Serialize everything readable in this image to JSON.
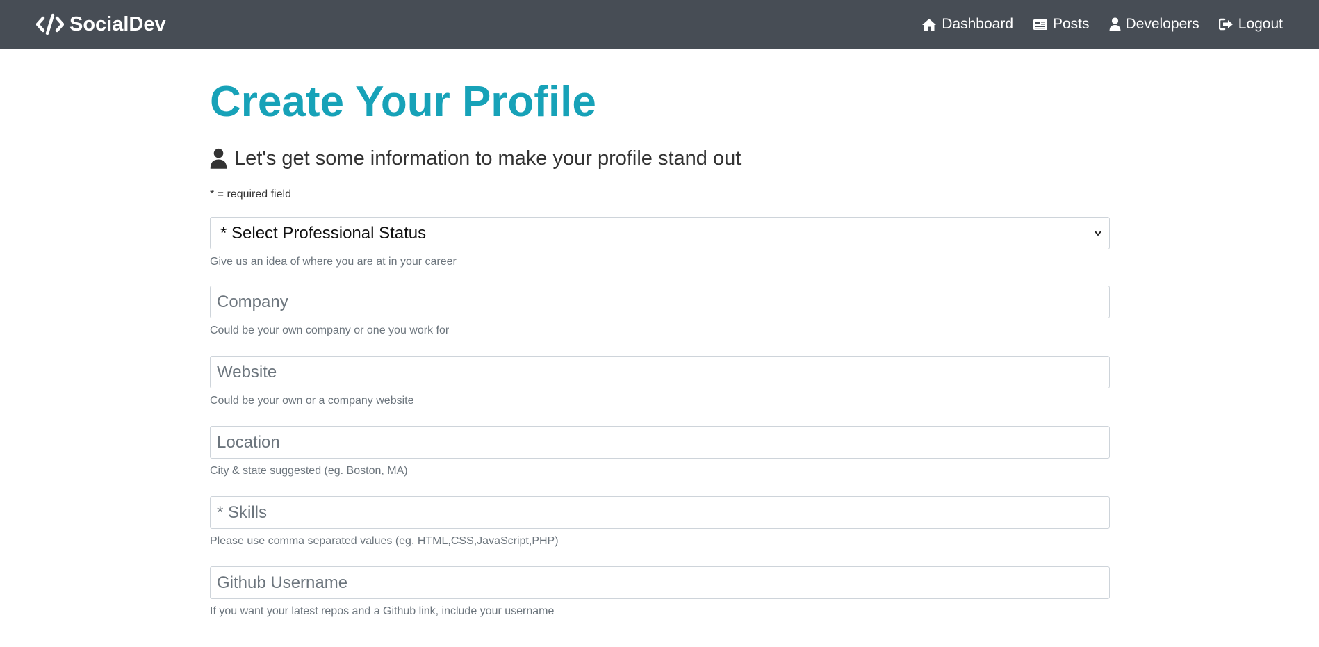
{
  "nav": {
    "brand": "SocialDev",
    "links": [
      {
        "label": "Dashboard",
        "icon": "home-icon"
      },
      {
        "label": "Posts",
        "icon": "newspaper-icon"
      },
      {
        "label": "Developers",
        "icon": "user-icon"
      },
      {
        "label": "Logout",
        "icon": "sign-out-icon"
      }
    ]
  },
  "page": {
    "title": "Create Your Profile",
    "lead": "Let's get some information to make your profile stand out",
    "required_note": "* = required field"
  },
  "form": {
    "status": {
      "selected": "* Select Professional Status",
      "hint": "Give us an idea of where you are at in your career"
    },
    "company": {
      "placeholder": "Company",
      "hint": "Could be your own company or one you work for"
    },
    "website": {
      "placeholder": "Website",
      "hint": "Could be your own or a company website"
    },
    "location": {
      "placeholder": "Location",
      "hint": "City & state suggested (eg. Boston, MA)"
    },
    "skills": {
      "placeholder": "* Skills",
      "hint": "Please use comma separated values (eg. HTML,CSS,JavaScript,PHP)"
    },
    "github": {
      "placeholder": "Github Username",
      "hint": "If you want your latest repos and a Github link, include your username"
    }
  },
  "colors": {
    "navbar": "#474d55",
    "accent": "#17a2b8",
    "hint": "#6c757d"
  }
}
